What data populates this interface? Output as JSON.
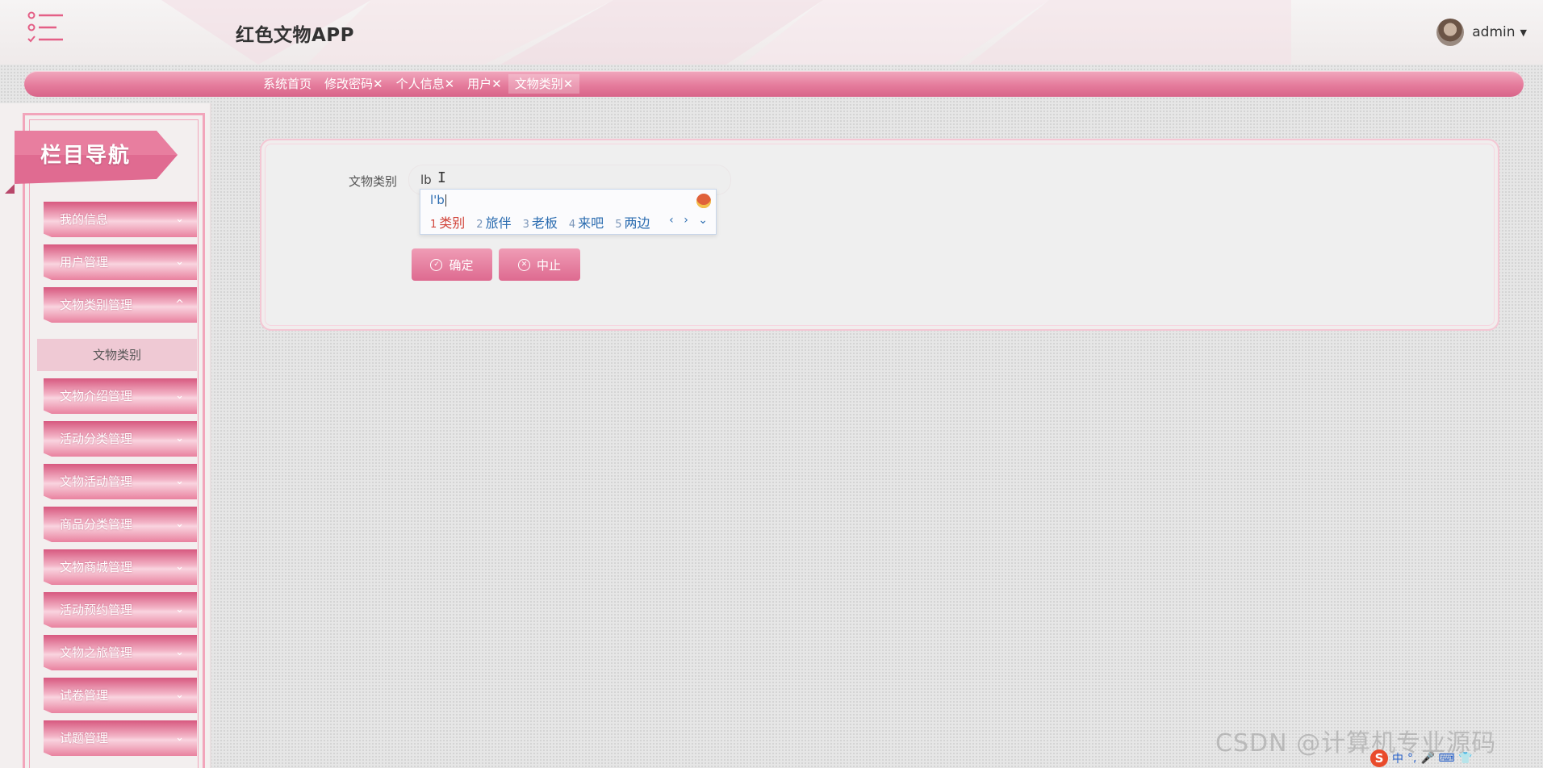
{
  "header": {
    "app_title": "红色文物APP",
    "user_name": "admin",
    "menu_icon": "list-menu-icon",
    "caret_icon": "caret-down-icon",
    "caret_glyph": "▼"
  },
  "tabs": [
    {
      "label": "系统首页"
    },
    {
      "label": "修改密码✕"
    },
    {
      "label": "个人信息✕"
    },
    {
      "label": "用户✕"
    },
    {
      "label": "文物类别✕",
      "active": true
    }
  ],
  "sidebar": {
    "title": "栏目导航",
    "expanded_icon": "^",
    "collapsed_icon": "⌄",
    "items": [
      {
        "label": "我的信息"
      },
      {
        "label": "用户管理"
      },
      {
        "label": "文物类别管理",
        "expanded": true
      },
      {
        "label": "文物介绍管理"
      },
      {
        "label": "活动分类管理"
      },
      {
        "label": "文物活动管理"
      },
      {
        "label": "商品分类管理"
      },
      {
        "label": "文物商城管理"
      },
      {
        "label": "活动预约管理"
      },
      {
        "label": "文物之旅管理"
      },
      {
        "label": "试卷管理"
      },
      {
        "label": "试题管理"
      }
    ],
    "sub_item": "文物类别"
  },
  "form": {
    "field_label": "文物类别",
    "field_value": "lb",
    "confirm_label": "确定",
    "cancel_label": "中止",
    "confirm_glyph": "✓",
    "cancel_glyph": "✕"
  },
  "ime": {
    "composition": "l'b",
    "candidates": [
      {
        "num": "1",
        "text": "类别"
      },
      {
        "num": "2",
        "text": "旅伴"
      },
      {
        "num": "3",
        "text": "老板"
      },
      {
        "num": "4",
        "text": "来吧"
      },
      {
        "num": "5",
        "text": "两边"
      }
    ],
    "nav": "‹ › ⌄"
  },
  "watermark": "CSDN @计算机专业源码",
  "tray": {
    "logo": "S",
    "lang": "中",
    "punct": "°,",
    "extra": "🎤 ⌨ 👕"
  },
  "colors": {
    "accent": "#e57c9c",
    "accent_dark": "#d86489",
    "ime_blue": "#2b6cb0",
    "ime_selected": "#d1443a"
  }
}
